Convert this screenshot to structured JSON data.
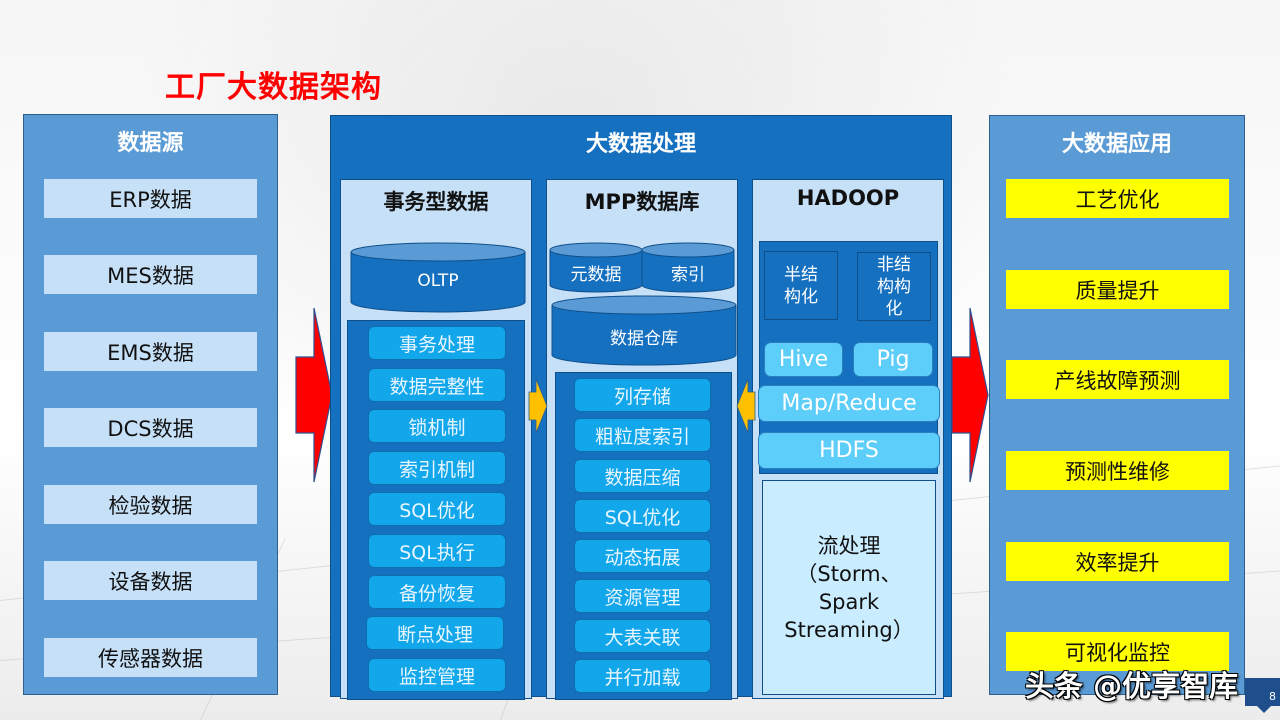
{
  "title": "工厂大数据架构",
  "sources": {
    "heading": "数据源",
    "items": [
      "ERP数据",
      "MES数据",
      "EMS数据",
      "DCS数据",
      "检验数据",
      "设备数据",
      "传感器数据"
    ]
  },
  "processing": {
    "heading": "大数据处理",
    "transactional": {
      "heading": "事务型数据",
      "db": "OLTP",
      "features": [
        "事务处理",
        "数据完整性",
        "锁机制",
        "索引机制",
        "SQL优化",
        "SQL执行",
        "备份恢复",
        "断点处理",
        "监控管理"
      ]
    },
    "mpp": {
      "heading": "MPP数据库",
      "meta_db": "元数据",
      "index_db": "索引",
      "warehouse_db": "数据仓库",
      "features": [
        "列存储",
        "粗粒度索引",
        "数据压缩",
        "SQL优化",
        "动态拓展",
        "资源管理",
        "大表关联",
        "并行加载"
      ]
    },
    "hadoop": {
      "heading": "HADOOP",
      "semi_structured": "半结\n构化",
      "unstructured": "非结\n构构\n化",
      "hive": "Hive",
      "pig": "Pig",
      "mapreduce": "Map/Reduce",
      "hdfs": "HDFS",
      "stream": "流处理\n（Storm、\nSpark\nStreaming）"
    }
  },
  "applications": {
    "heading": "大数据应用",
    "items": [
      "工艺优化",
      "质量提升",
      "产线故障预测",
      "预测性维修",
      "效率提升",
      "可视化监控"
    ]
  },
  "watermark": "头条 @优享智库",
  "page_number": "8",
  "colors": {
    "title": "#ff0000",
    "panel_side": "#5b9bd5",
    "panel_center": "#1570c0",
    "column_bg": "#c6e0f7",
    "feature_pill": "#12a6eb",
    "hadoop_pill": "#5dcdfa",
    "app_item": "#ffff00",
    "flow_arrow_big": "#ff0000",
    "flow_arrow_small": "#ffc000"
  }
}
